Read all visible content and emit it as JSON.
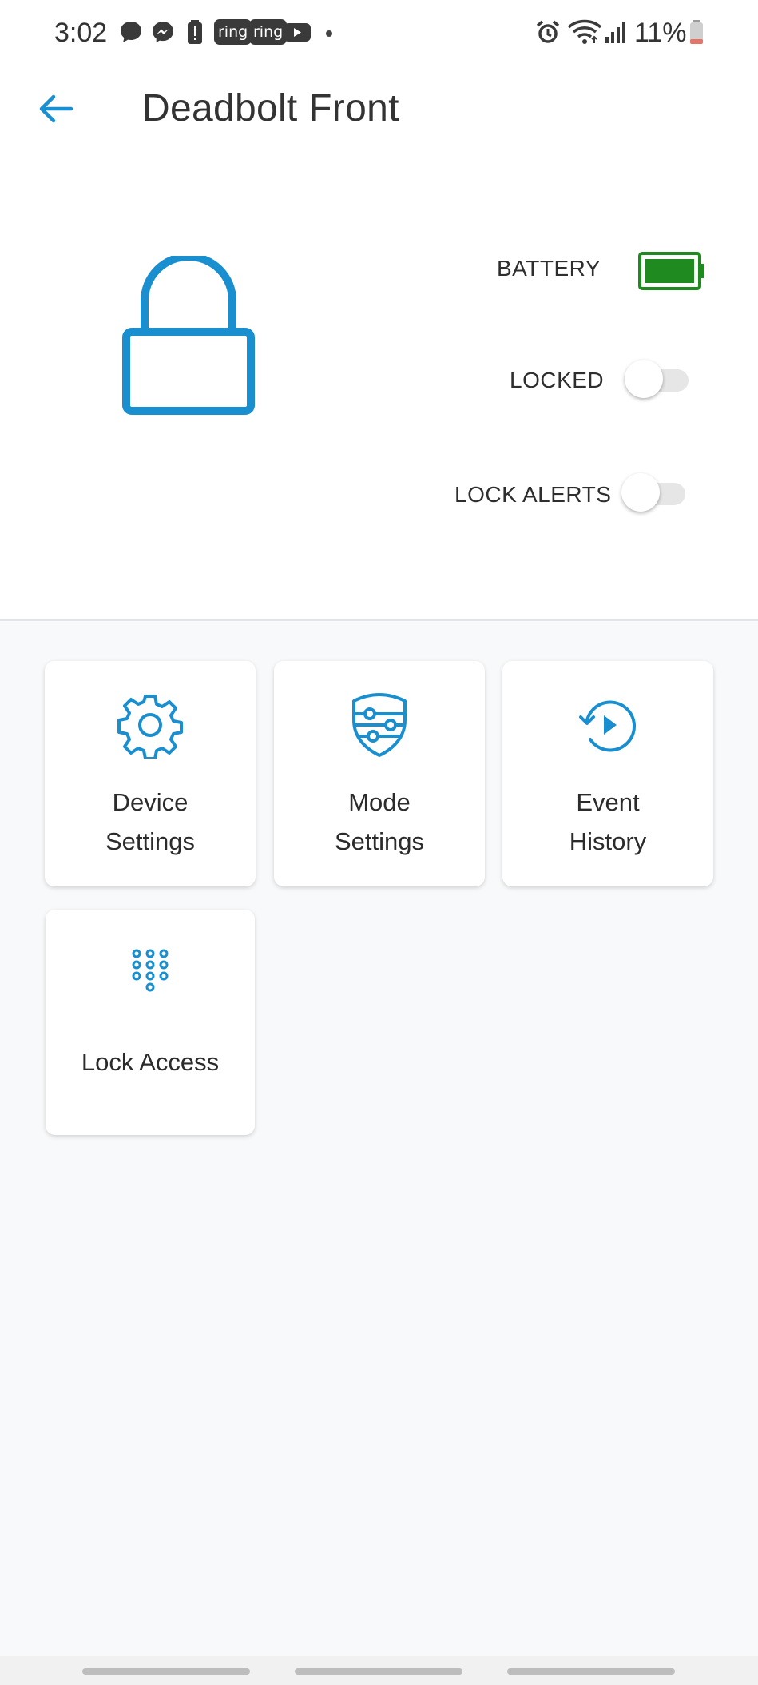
{
  "status_bar": {
    "time": "3:02",
    "badges": [
      "ring",
      "ring"
    ],
    "battery_percent": "11%",
    "icons": [
      "chat-bubble-icon",
      "messenger-icon",
      "battery-alert-icon",
      "youtube-icon",
      "alarm-icon",
      "wifi-icon",
      "signal-icon",
      "battery-low-icon"
    ]
  },
  "header": {
    "title": "Deadbolt Front",
    "back_icon": "arrow-left-icon"
  },
  "device": {
    "lock_icon": "padlock-icon",
    "battery_label": "BATTERY",
    "battery_color": "#1f8a1f",
    "locked_label": "LOCKED",
    "locked_on": false,
    "lock_alerts_label": "LOCK ALERTS",
    "lock_alerts_on": false
  },
  "tiles": [
    {
      "icon": "gear-icon",
      "line1": "Device",
      "line2": "Settings"
    },
    {
      "icon": "shield-sliders-icon",
      "line1": "Mode",
      "line2": "Settings"
    },
    {
      "icon": "history-play-icon",
      "line1": "Event",
      "line2": "History"
    },
    {
      "icon": "keypad-icon",
      "line1": "Lock Access"
    }
  ],
  "colors": {
    "accent": "#1a8fd0",
    "tile_background": "#ffffff",
    "grid_background": "#f8f9fb"
  }
}
